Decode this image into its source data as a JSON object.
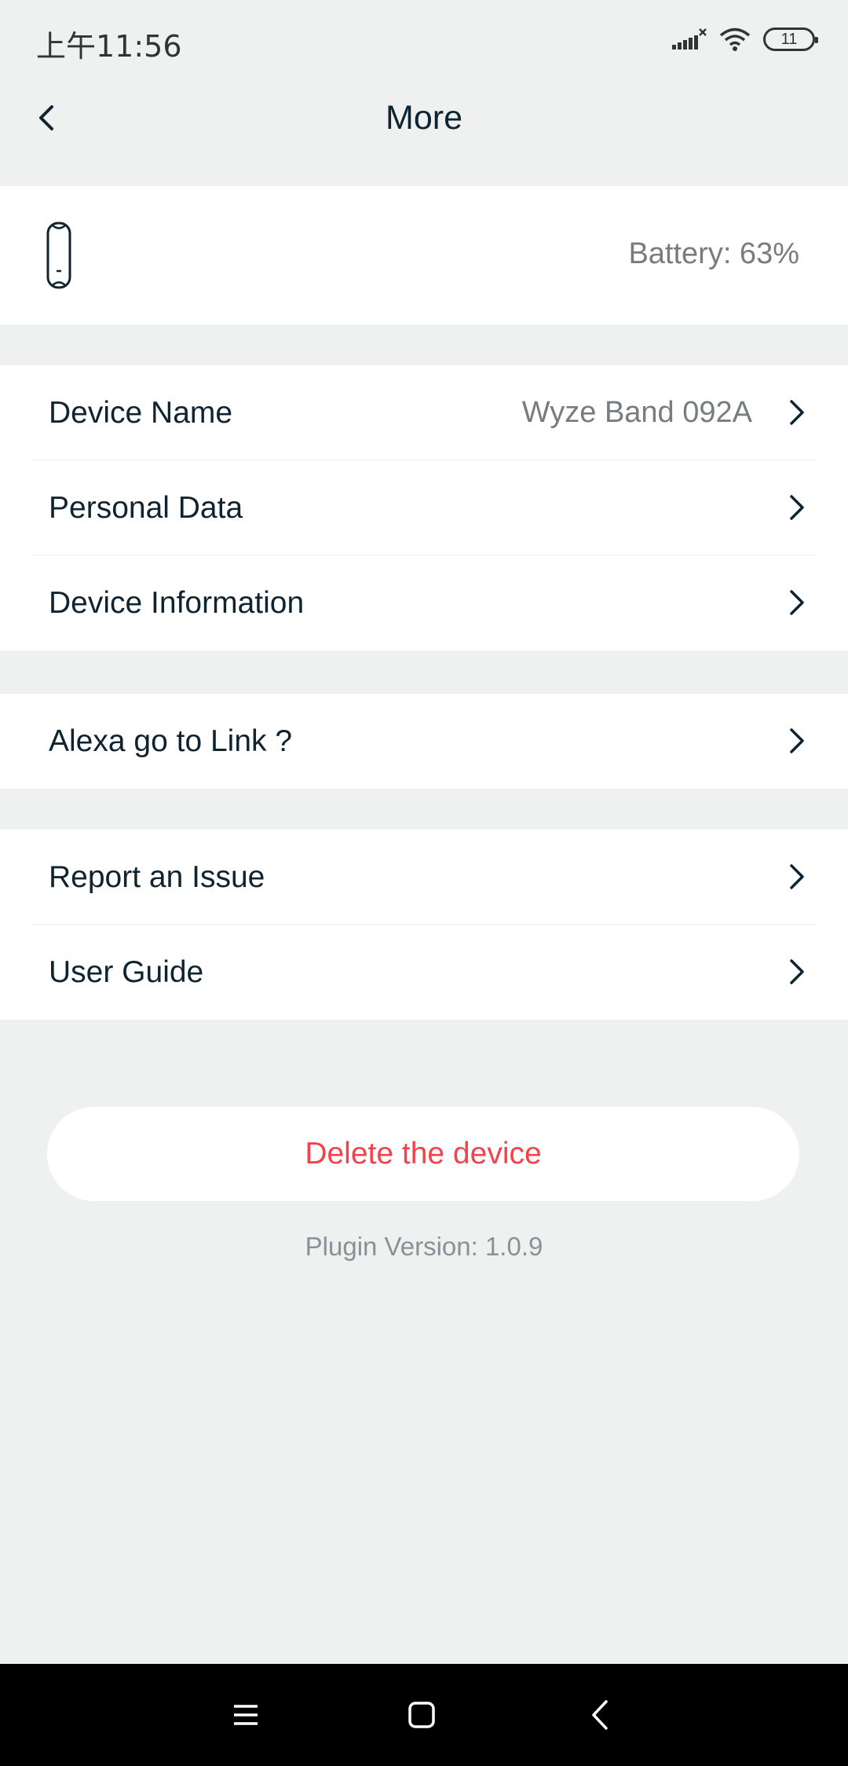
{
  "status_bar": {
    "time": "上午11:56",
    "battery_level": "11",
    "icons": [
      "signal-icon",
      "wifi-icon",
      "battery-icon"
    ]
  },
  "header": {
    "title": "More",
    "back_icon": "chevron-left-icon"
  },
  "device": {
    "icon": "band-icon",
    "battery": "Battery: 63%"
  },
  "settings": {
    "group1": [
      {
        "label": "Device Name",
        "value": "Wyze Band 092A"
      },
      {
        "label": "Personal Data"
      },
      {
        "label": "Device Information"
      }
    ],
    "group2": [
      {
        "label": "Alexa go to Link ?"
      }
    ],
    "group3": [
      {
        "label": "Report an Issue"
      },
      {
        "label": "User Guide"
      }
    ]
  },
  "actions": {
    "delete_label": "Delete the device",
    "plugin_version": "Plugin Version: 1.0.9"
  },
  "colors": {
    "background": "#eff1f1",
    "card": "#ffffff",
    "primary_text": "#0f2430",
    "secondary_text": "#777c80",
    "danger": "#f4424a"
  },
  "nav_bar": {
    "icons": [
      "menu-icon",
      "home-icon",
      "back-icon"
    ]
  }
}
